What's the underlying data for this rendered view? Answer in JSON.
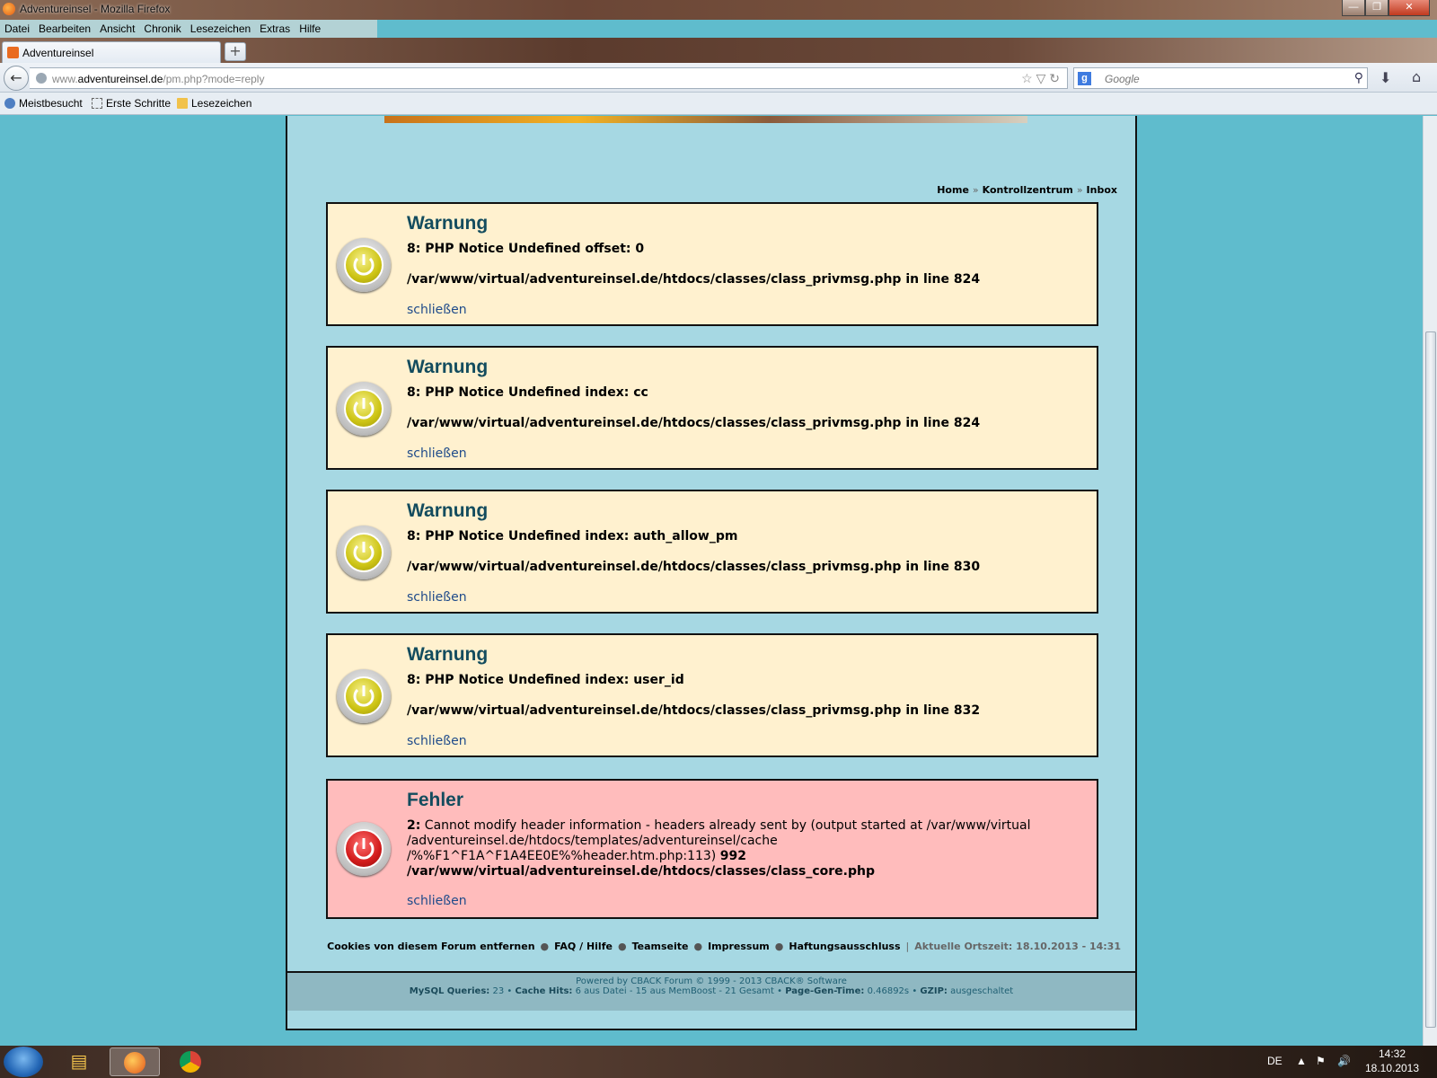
{
  "window": {
    "title": "Adventureinsel - Mozilla Firefox",
    "min_glyph": "—",
    "max_glyph": "❐",
    "close_glyph": "✕"
  },
  "menu": [
    "Datei",
    "Bearbeiten",
    "Ansicht",
    "Chronik",
    "Lesezeichen",
    "Extras",
    "Hilfe"
  ],
  "tab": {
    "label": "Adventureinsel",
    "new_tab": "+"
  },
  "nav": {
    "back_glyph": "←",
    "url_domain_prefix": "www.",
    "url_domain": "adventureinsel.de",
    "url_path": "/pm.php?mode=reply",
    "url_icons": "☆ ▽ ↻",
    "search_engine_letter": "g",
    "search_placeholder": "Google",
    "search_glyph": "⚲",
    "download_glyph": "⬇",
    "home_glyph": "⌂"
  },
  "bookmarks": [
    "Meistbesucht",
    "Erste Schritte",
    "Lesezeichen"
  ],
  "breadcrumb": {
    "home": "Home",
    "sep": "»",
    "control": "Kontrollzentrum",
    "inbox": "Inbox"
  },
  "messages": [
    {
      "title": "Warnung",
      "line1": "8: PHP Notice Undefined offset: 0",
      "line2": "/var/www/virtual/adventureinsel.de/htdocs/classes/class_privmsg.php in line 824",
      "close": "schließen"
    },
    {
      "title": "Warnung",
      "line1": "8: PHP Notice Undefined index: cc",
      "line2": "/var/www/virtual/adventureinsel.de/htdocs/classes/class_privmsg.php in line 824",
      "close": "schließen"
    },
    {
      "title": "Warnung",
      "line1": "8: PHP Notice Undefined index: auth_allow_pm",
      "line2": "/var/www/virtual/adventureinsel.de/htdocs/classes/class_privmsg.php in line 830",
      "close": "schließen"
    },
    {
      "title": "Warnung",
      "line1": "8: PHP Notice Undefined index: user_id",
      "line2": "/var/www/virtual/adventureinsel.de/htdocs/classes/class_privmsg.php in line 832",
      "close": "schließen"
    }
  ],
  "error": {
    "title": "Fehler",
    "code": "2:",
    "text1": " Cannot modify header information - headers already sent by (output started at /var/www/virtual",
    "text2": "/adventureinsel.de/htdocs/templates/adventureinsel/cache",
    "text3": "/%%F1^F1A^F1A4EE0E%%header.htm.php:113)",
    "line_no": "992",
    "file": "/var/www/virtual/adventureinsel.de/htdocs/classes/class_core.php",
    "close": "schließen"
  },
  "footer": {
    "links": [
      "Cookies von diesem Forum entfernen",
      "FAQ / Hilfe",
      "Teamseite",
      "Impressum",
      "Haftungsausschluss"
    ],
    "dot": "●",
    "pipe": "|",
    "time": "Aktuelle Ortszeit: 18.10.2013 - 14:31",
    "powered": "Powered by CBACK Forum © 1999 - 2013 CBACK® Software",
    "mysql_label": "MySQL Queries:",
    "mysql_value": "23",
    "bullet": "•",
    "cache_label": "Cache Hits:",
    "cache_value": "6 aus Datei - 15 aus MemBoost - 21 Gesamt",
    "pagegen_label": "Page-Gen-Time:",
    "pagegen_value": "0.46892s",
    "gzip_label": "GZIP:",
    "gzip_value": "ausgeschaltet"
  },
  "taskbar": {
    "lang": "DE",
    "time": "14:32",
    "date": "18.10.2013",
    "tray_up": "▲",
    "tray_flag": "⚑",
    "tray_volume": "🔊"
  }
}
